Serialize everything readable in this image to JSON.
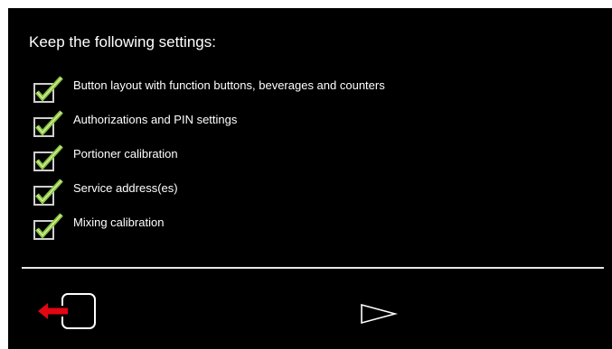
{
  "screen": {
    "heading": "Keep the following settings:"
  },
  "settings": [
    {
      "label": "Button layout with function buttons, beverages and counters",
      "checked": true
    },
    {
      "label": "Authorizations and PIN settings",
      "checked": true
    },
    {
      "label": "Portioner calibration",
      "checked": true
    },
    {
      "label": "Service address(es)",
      "checked": true
    },
    {
      "label": "Mixing calibration",
      "checked": true
    }
  ],
  "colors": {
    "background": "#000000",
    "text": "#ffffff",
    "checkmark": "#8cc63f",
    "checkbox_border": "#cfcfcf",
    "back_arrow": "#e30613",
    "divider": "#e8e8e8"
  },
  "icons": {
    "checkbox": "checkbox-checked-icon",
    "back": "exit-arrow-left-icon",
    "forward": "play-triangle-outline-icon"
  }
}
